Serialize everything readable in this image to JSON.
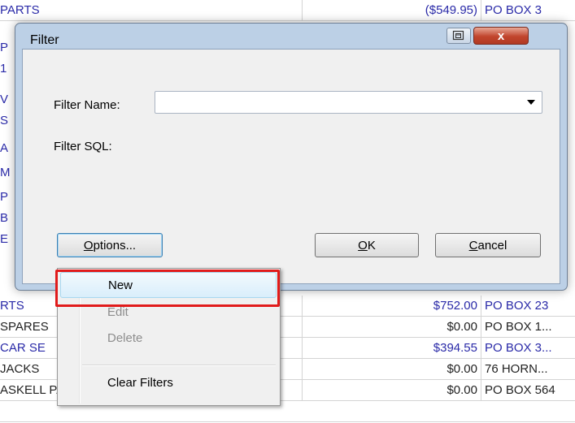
{
  "background": {
    "rows": [
      {
        "col1": "PARTS",
        "col2": "($549.95)",
        "col3": "PO BOX 3"
      },
      {
        "col1": "RTS",
        "col2": "$752.00",
        "col3": "PO BOX 23"
      },
      {
        "col1": "SPARES",
        "col2": "$0.00",
        "col3": "PO BOX 1..."
      },
      {
        "col1": "CAR SE",
        "col2": "$394.55",
        "col3": "PO BOX 3..."
      },
      {
        "col1": "JACKS",
        "col2": "$0.00",
        "col3": "76 HORN..."
      },
      {
        "col1": "ASKELL PARTS CENTRE",
        "col2": "$0.00",
        "col3": "PO BOX 564"
      }
    ],
    "left_letters": [
      "P",
      "1",
      "V",
      "S",
      "A",
      "M",
      "P",
      "B",
      "E"
    ]
  },
  "dialog": {
    "title": "Filter",
    "close_label": "x",
    "filter_name_label": "Filter Name:",
    "filter_name_value": "",
    "filter_sql_label": "Filter SQL:",
    "options_label_u": "O",
    "options_label_rest": "ptions...",
    "ok_label_u": "O",
    "ok_label_rest": "K",
    "cancel_label_u": "C",
    "cancel_label_rest": "ancel"
  },
  "menu": {
    "new": "New",
    "edit": "Edit",
    "delete": "Delete",
    "clear_filters": "Clear Filters"
  },
  "colors": {
    "highlight": "#e11b1b",
    "link_text": "#2a2aa8"
  }
}
